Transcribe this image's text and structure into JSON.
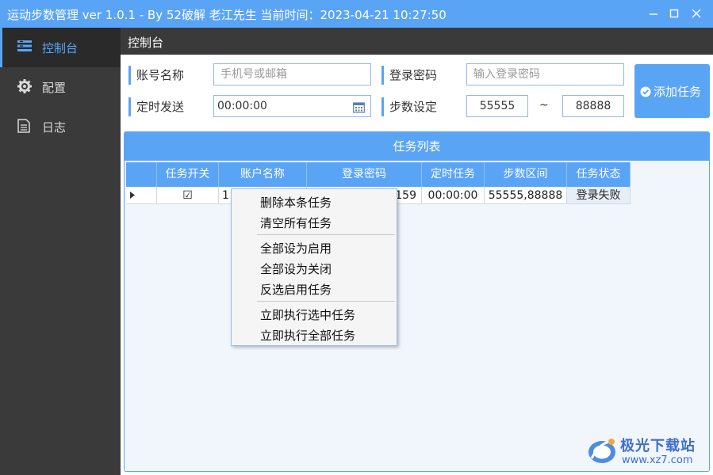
{
  "window": {
    "title": "运动步数管理 ver 1.0.1 - By 52破解 老江先生 当前时间：2023-04-21 10:27:50",
    "controls": [
      "minimize",
      "maximize",
      "close"
    ]
  },
  "sidebar": {
    "items": [
      {
        "label": "控制台",
        "icon": "console-icon",
        "active": true
      },
      {
        "label": "配置",
        "icon": "gear-icon",
        "active": false
      },
      {
        "label": "日志",
        "icon": "log-icon",
        "active": false
      }
    ]
  },
  "header": {
    "title": "控制台"
  },
  "form": {
    "account_label": "账号名称",
    "account_placeholder": "手机号或邮箱",
    "password_label": "登录密码",
    "password_placeholder": "输入登录密码",
    "schedule_label": "定时发送",
    "schedule_value": "00:00:00",
    "steps_label": "步数设定",
    "steps_min": "55555",
    "steps_sep": "~",
    "steps_max": "88888",
    "add_button": "添加任务"
  },
  "task_list": {
    "title": "任务列表",
    "columns": [
      "任务开关",
      "账户名称",
      "登录密码",
      "定时任务",
      "步数区间",
      "任务状态"
    ],
    "rows": [
      {
        "enabled_mark": "☑",
        "account": "1",
        "password": "159",
        "schedule": "00:00:00",
        "steps": "55555,88888",
        "status": "登录失败"
      }
    ]
  },
  "context_menu": {
    "items": [
      "删除本条任务",
      "清空所有任务",
      "全部设为启用",
      "全部设为关闭",
      "反选启用任务",
      "立即执行选中任务",
      "立即执行全部任务"
    ]
  },
  "watermark": {
    "name": "极光下载站",
    "url": "www.xz7.com"
  },
  "colors": {
    "accent": "#5aa4f6",
    "sidebar": "#3a3a3a",
    "panel_bg": "#f1f6fd"
  }
}
